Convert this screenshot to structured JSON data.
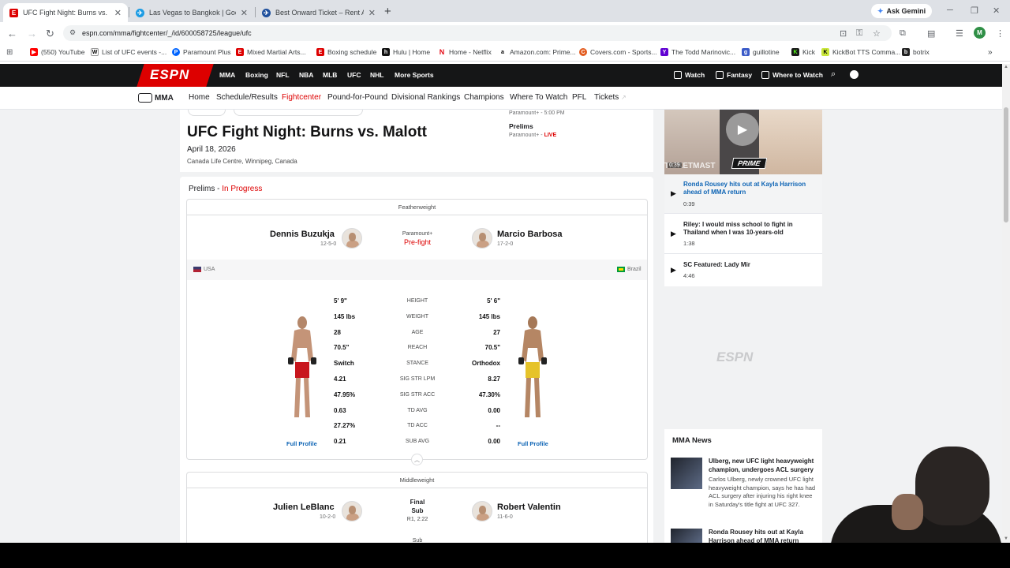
{
  "browser": {
    "tabs": [
      {
        "title": "UFC Fight Night: Burns vs. Malott",
        "active": true
      },
      {
        "title": "Las Vegas to Bangkok | Google",
        "active": false
      },
      {
        "title": "Best Onward Ticket – Rent A Pl",
        "active": false
      }
    ],
    "ask_gemini": "Ask Gemini",
    "url": "espn.com/mma/fightcenter/_/id/600058725/league/ufc",
    "profile_initial": "M",
    "bookmarks": [
      "(550) YouTube",
      "List of UFC events -...",
      "Paramount Plus",
      "Mixed Martial Arts...",
      "Boxing schedule",
      "Hulu | Home",
      "Home - Netflix",
      "Amazon.com: Prime...",
      "Covers.com - Sports...",
      "The Todd Marinovic...",
      "guillotine",
      "Kick",
      "KickBot TTS Comma...",
      "botrix"
    ]
  },
  "espn": {
    "logo": "ESPN",
    "top_nav": [
      "MMA",
      "Boxing",
      "NFL",
      "NBA",
      "MLB",
      "UFC",
      "NHL",
      "More Sports"
    ],
    "top_right": [
      "Watch",
      "Fantasy",
      "Where to Watch"
    ],
    "mma_label": "MMA",
    "sub_nav": [
      "Home",
      "Schedule/Results",
      "Fightcenter",
      "Pound-for-Pound",
      "Divisional Rankings",
      "Champions",
      "Where To Watch",
      "PFL",
      "Tickets"
    ]
  },
  "event": {
    "title": "UFC Fight Night: Burns vs. Malott",
    "date": "April 18, 2026",
    "venue": "Canada Life Centre, Winnipeg, Canada",
    "broadcast_top": "Paramount+ - 5:00 PM",
    "prelims_label": "Prelims",
    "broadcast_network": "Paramount+",
    "broadcast_live": "LIVE"
  },
  "card": {
    "section": "Prelims",
    "status": "In Progress"
  },
  "fight1": {
    "weight_class": "Featherweight",
    "network": "Paramount+",
    "status": "Pre-fight",
    "left": {
      "name": "Dennis Buzukja",
      "record": "12-5-0",
      "country": "USA"
    },
    "right": {
      "name": "Marcio Barbosa",
      "record": "17-2-0",
      "country": "Brazil"
    },
    "stats": [
      {
        "label": "HEIGHT",
        "left": "5' 9\"",
        "right": "5' 6\""
      },
      {
        "label": "WEIGHT",
        "left": "145 lbs",
        "right": "145 lbs"
      },
      {
        "label": "AGE",
        "left": "28",
        "right": "27"
      },
      {
        "label": "REACH",
        "left": "70.5\"",
        "right": "70.5\""
      },
      {
        "label": "STANCE",
        "left": "Switch",
        "right": "Orthodox"
      },
      {
        "label": "SIG STR LPM",
        "left": "4.21",
        "right": "8.27"
      },
      {
        "label": "SIG STR ACC",
        "left": "47.95%",
        "right": "47.30%"
      },
      {
        "label": "TD AVG",
        "left": "0.63",
        "right": "0.00"
      },
      {
        "label": "TD ACC",
        "left": "27.27%",
        "right": "--"
      },
      {
        "label": "SUB AVG",
        "left": "0.21",
        "right": "0.00"
      }
    ],
    "full_profile": "Full Profile"
  },
  "fight2": {
    "weight_class": "Middleweight",
    "result": "Final",
    "method": "Sub",
    "round_time": "R1, 2:22",
    "left": {
      "name": "Julien LeBlanc",
      "record": "10-2-0"
    },
    "right": {
      "name": "Robert Valentin",
      "record": "11-6-0"
    },
    "next_row_peek": "Sub"
  },
  "video": {
    "badge": "PRIME",
    "watermark": "TICKETMAST",
    "duration": "0:39",
    "playlist": [
      {
        "title": "Ronda Rousey hits out at Kayla Harrison ahead of MMA return",
        "time": "0:39",
        "selected": true
      },
      {
        "title": "Riley: I would miss school to fight in Thailand when I was 10-years-old",
        "time": "1:38",
        "selected": false
      },
      {
        "title": "SC Featured: Lady Mir",
        "time": "4:46",
        "selected": false
      }
    ]
  },
  "ad_logo": "ESPN",
  "news": {
    "header": "MMA News",
    "items": [
      {
        "headline": "Ulberg, new UFC light heavyweight champion, undergoes ACL surgery",
        "body": "Carlos Ulberg, newly crowned UFC light heavyweight champion, says he has had ACL surgery after injuring his right knee in Saturday's title fight at UFC 327."
      },
      {
        "headline": "Ronda Rousey hits out at Kayla Harrison ahead of MMA return",
        "body": ""
      }
    ]
  }
}
